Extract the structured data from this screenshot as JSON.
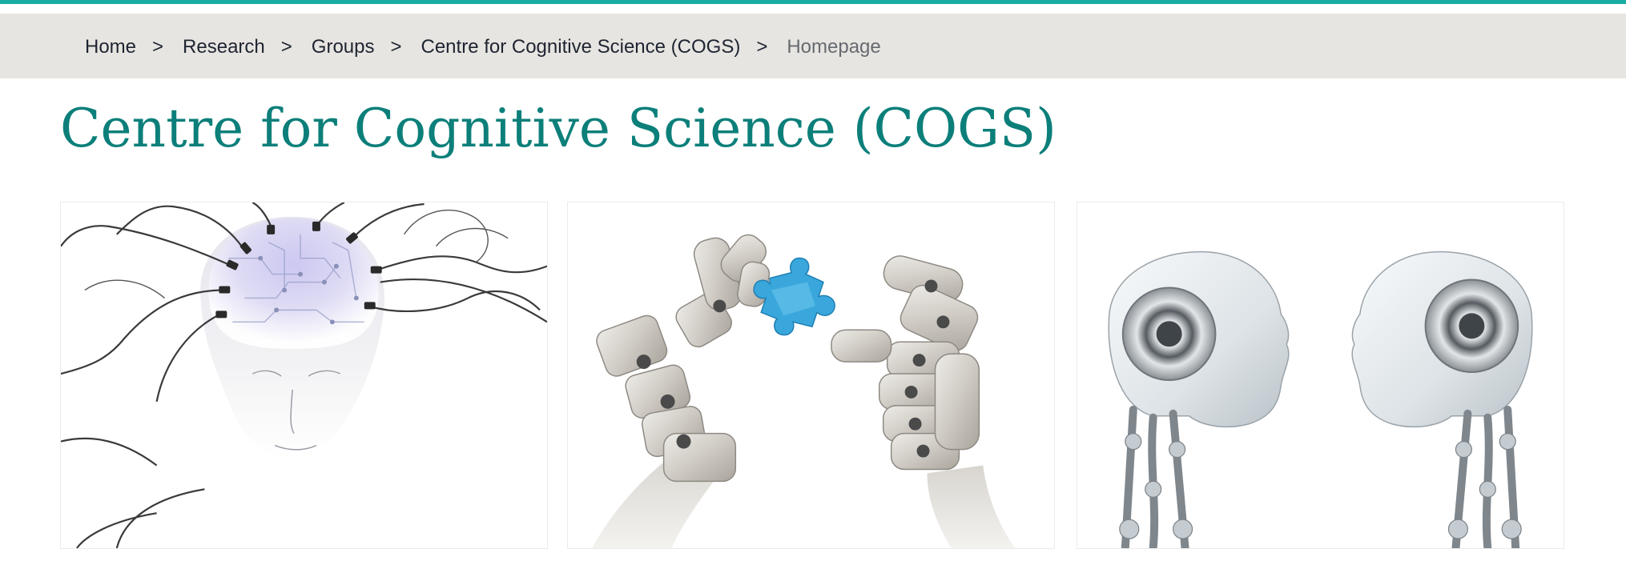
{
  "breadcrumb": {
    "items": [
      {
        "label": "Home"
      },
      {
        "label": "Research"
      },
      {
        "label": "Groups"
      },
      {
        "label": "Centre for Cognitive Science (COGS)"
      }
    ],
    "separator": ">",
    "current": "Homepage"
  },
  "page": {
    "title": "Centre for Cognitive Science (COGS)"
  },
  "images": [
    {
      "subject": "head-with-electrodes"
    },
    {
      "subject": "robot-hands-with-puzzle-piece"
    },
    {
      "subject": "two-robot-heads-facing"
    }
  ],
  "colors": {
    "accent_rule": "#19ada2",
    "breadcrumb_background": "#e7e5e1",
    "title": "#0c7f7a",
    "puzzle_piece": "#3aa7dc"
  }
}
